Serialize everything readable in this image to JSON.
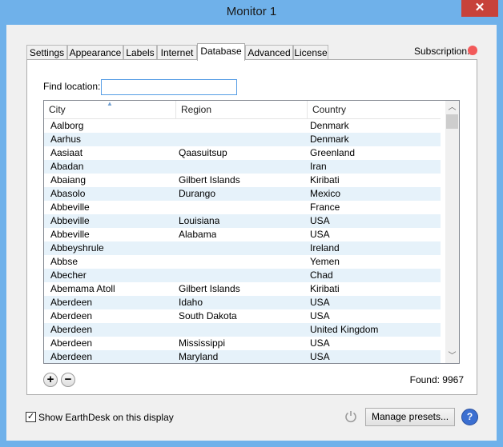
{
  "window": {
    "title": "Monitor 1",
    "close_glyph": "✕"
  },
  "tabs": [
    {
      "label": "Settings"
    },
    {
      "label": "Appearance"
    },
    {
      "label": "Labels"
    },
    {
      "label": "Internet"
    },
    {
      "label": "Database",
      "active": true
    },
    {
      "label": "Advanced"
    },
    {
      "label": "License"
    }
  ],
  "subscription": {
    "label": "Subscription:",
    "status_color": "#f25a5a"
  },
  "find": {
    "label": "Find location:",
    "value": ""
  },
  "table": {
    "columns": [
      "City",
      "Region",
      "Country"
    ],
    "sorted_column": "City",
    "rows": [
      [
        "Aalborg",
        "",
        "Denmark"
      ],
      [
        "Aarhus",
        "",
        "Denmark"
      ],
      [
        "Aasiaat",
        "Qaasuitsup",
        "Greenland"
      ],
      [
        "Abadan",
        "",
        "Iran"
      ],
      [
        "Abaiang",
        "Gilbert Islands",
        "Kiribati"
      ],
      [
        "Abasolo",
        "Durango",
        "Mexico"
      ],
      [
        "Abbeville",
        "",
        "France"
      ],
      [
        "Abbeville",
        "Louisiana",
        "USA"
      ],
      [
        "Abbeville",
        "Alabama",
        "USA"
      ],
      [
        "Abbeyshrule",
        "",
        "Ireland"
      ],
      [
        "Abbse",
        "",
        "Yemen"
      ],
      [
        "Abecher",
        "",
        "Chad"
      ],
      [
        "Abemama Atoll",
        "Gilbert Islands",
        "Kiribati"
      ],
      [
        "Aberdeen",
        "Idaho",
        "USA"
      ],
      [
        "Aberdeen",
        "South Dakota",
        "USA"
      ],
      [
        "Aberdeen",
        "",
        "United Kingdom"
      ],
      [
        "Aberdeen",
        "Mississippi",
        "USA"
      ],
      [
        "Aberdeen",
        "Maryland",
        "USA"
      ]
    ]
  },
  "buttons": {
    "add": "+",
    "remove": "−",
    "manage_presets": "Manage presets...",
    "help": "?"
  },
  "found": {
    "text": "Found: 9967"
  },
  "footer": {
    "show_checkbox_label": "Show EarthDesk on this display",
    "checked": true
  }
}
